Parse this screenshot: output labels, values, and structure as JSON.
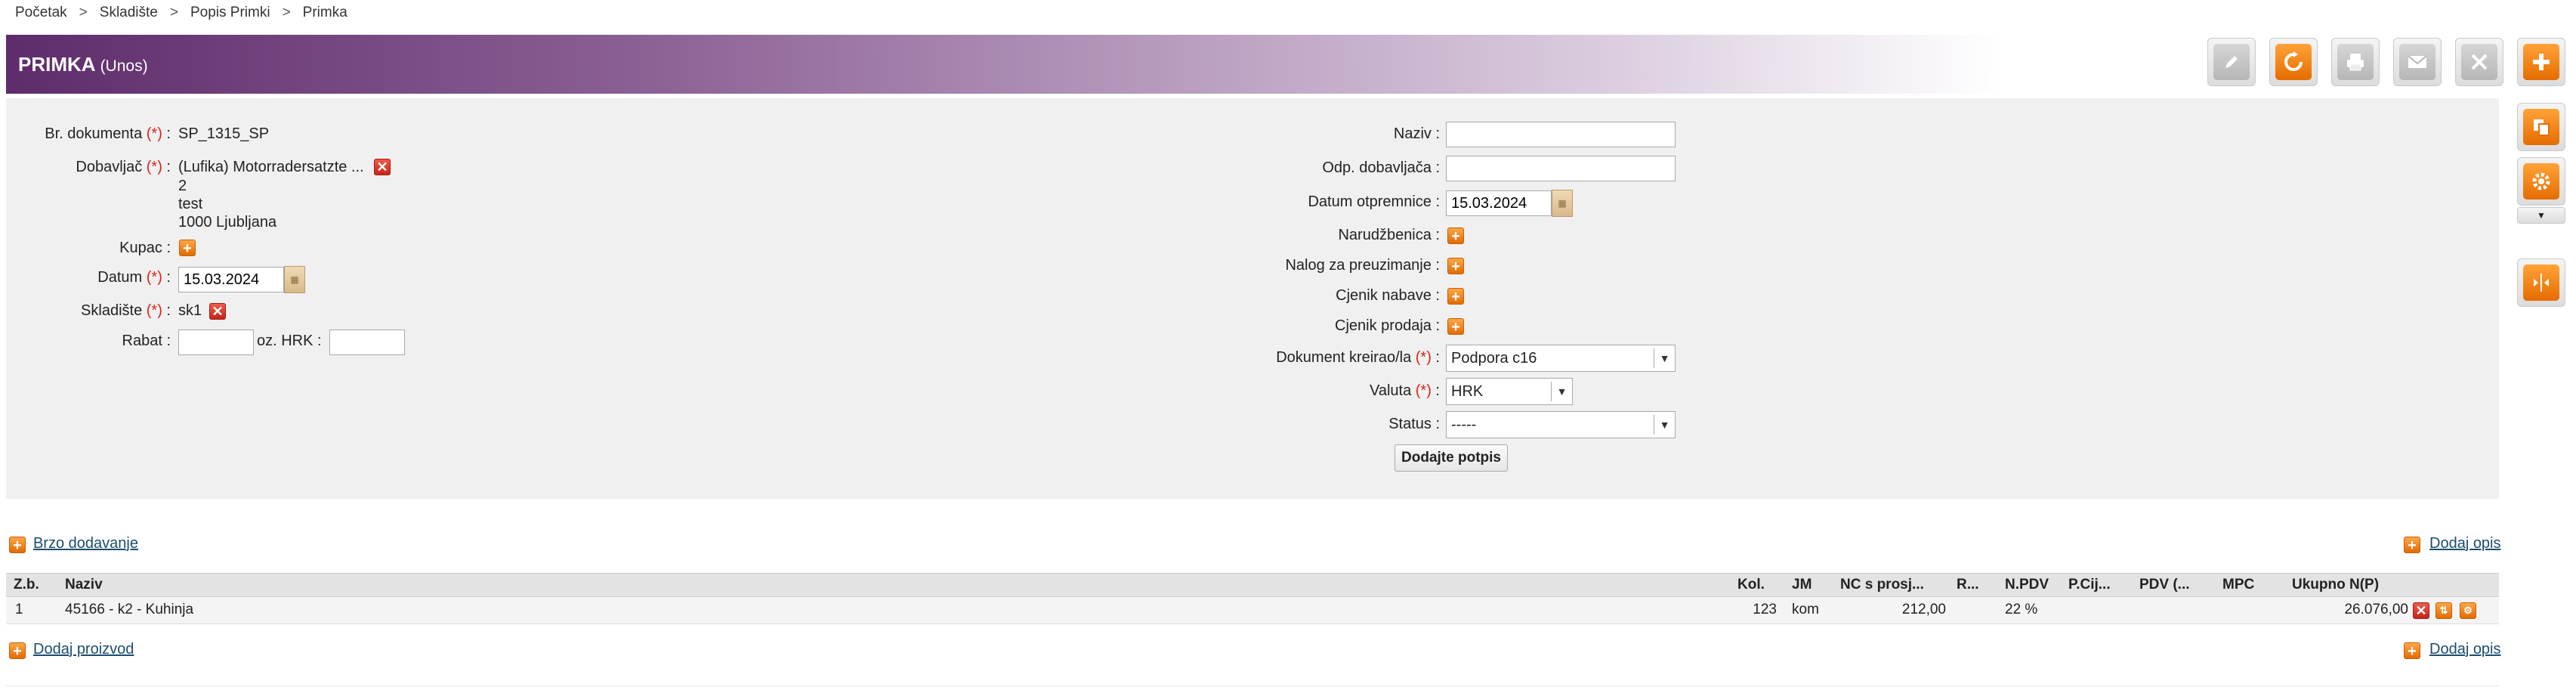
{
  "breadcrumb": [
    "Početak",
    "Skladište",
    "Popis Primki",
    "Primka"
  ],
  "breadcrumb_sep": ">",
  "header": {
    "title": "PRIMKA",
    "mode": "(Unos)"
  },
  "toolbar": [
    "edit-icon",
    "refresh-icon",
    "print-icon",
    "mail-icon",
    "close-icon",
    "add-icon"
  ],
  "side_tools": [
    "copy-icon",
    "settings-icon",
    "split-icon"
  ],
  "form_left": {
    "br_dokumenta_label": "Br. dokumenta",
    "br_dokumenta_value": "SP_1315_SP",
    "dobavljac_label": "Dobavljač",
    "dobavljac_lines": [
      "(Lufika) Motorradersatzte ...",
      "2",
      "test",
      "1000 Ljubljana"
    ],
    "kupac_label": "Kupac :",
    "datum_label": "Datum",
    "datum_value": "15.03.2024",
    "skladiste_label": "Skladište",
    "skladiste_value": "sk1",
    "rabat_label": "Rabat :",
    "rabat_value": "",
    "oz_hrk_label": "oz. HRK :",
    "oz_hrk_value": ""
  },
  "required_mark": "(*)",
  "colon": " :",
  "form_right": {
    "naziv_label": "Naziv :",
    "naziv_value": "",
    "odp_dobavljaca_label": "Odp. dobavljača :",
    "odp_dobavljaca_value": "",
    "datum_otpremnice_label": "Datum otpremnice :",
    "datum_otpremnice_value": "15.03.2024",
    "narudzbenica_label": "Narudžbenica :",
    "nalog_label": "Nalog za preuzimanje :",
    "cjenik_nabave_label": "Cjenik nabave :",
    "cjenik_prodaja_label": "Cjenik prodaja :",
    "dokument_kreirao_label": "Dokument kreirao/la",
    "dokument_kreirao_value": "Podpora c16",
    "valuta_label": "Valuta",
    "valuta_value": "HRK",
    "status_label": "Status :",
    "status_value": "-----",
    "sign_button": "Dodajte potpis"
  },
  "links": {
    "brzo_dodavanje": "Brzo dodavanje",
    "dodaj_opis": "Dodaj opis",
    "dodaj_proizvod": "Dodaj proizvod"
  },
  "table": {
    "headers": [
      "Z.b.",
      "Naziv",
      "Kol.",
      "JM",
      "NC s prosj...",
      "R...",
      "N.PDV",
      "P.Cij...",
      "PDV (...",
      "MPC",
      "Ukupno N(P)"
    ],
    "rows": [
      {
        "zb": "1",
        "naziv": "45166 - k2 - Kuhinja",
        "kol": "123",
        "jm": "kom",
        "nc": "212,00",
        "r": "",
        "npdv": "22 %",
        "pcij": "",
        "pdv": "",
        "mpc": "",
        "ukupno": "26.076,00"
      }
    ]
  },
  "colors": {
    "header_dark": "#5e2c6b",
    "accent_orange": "#e56c00",
    "required_red": "#d9241b",
    "link": "#1a4d6e"
  }
}
